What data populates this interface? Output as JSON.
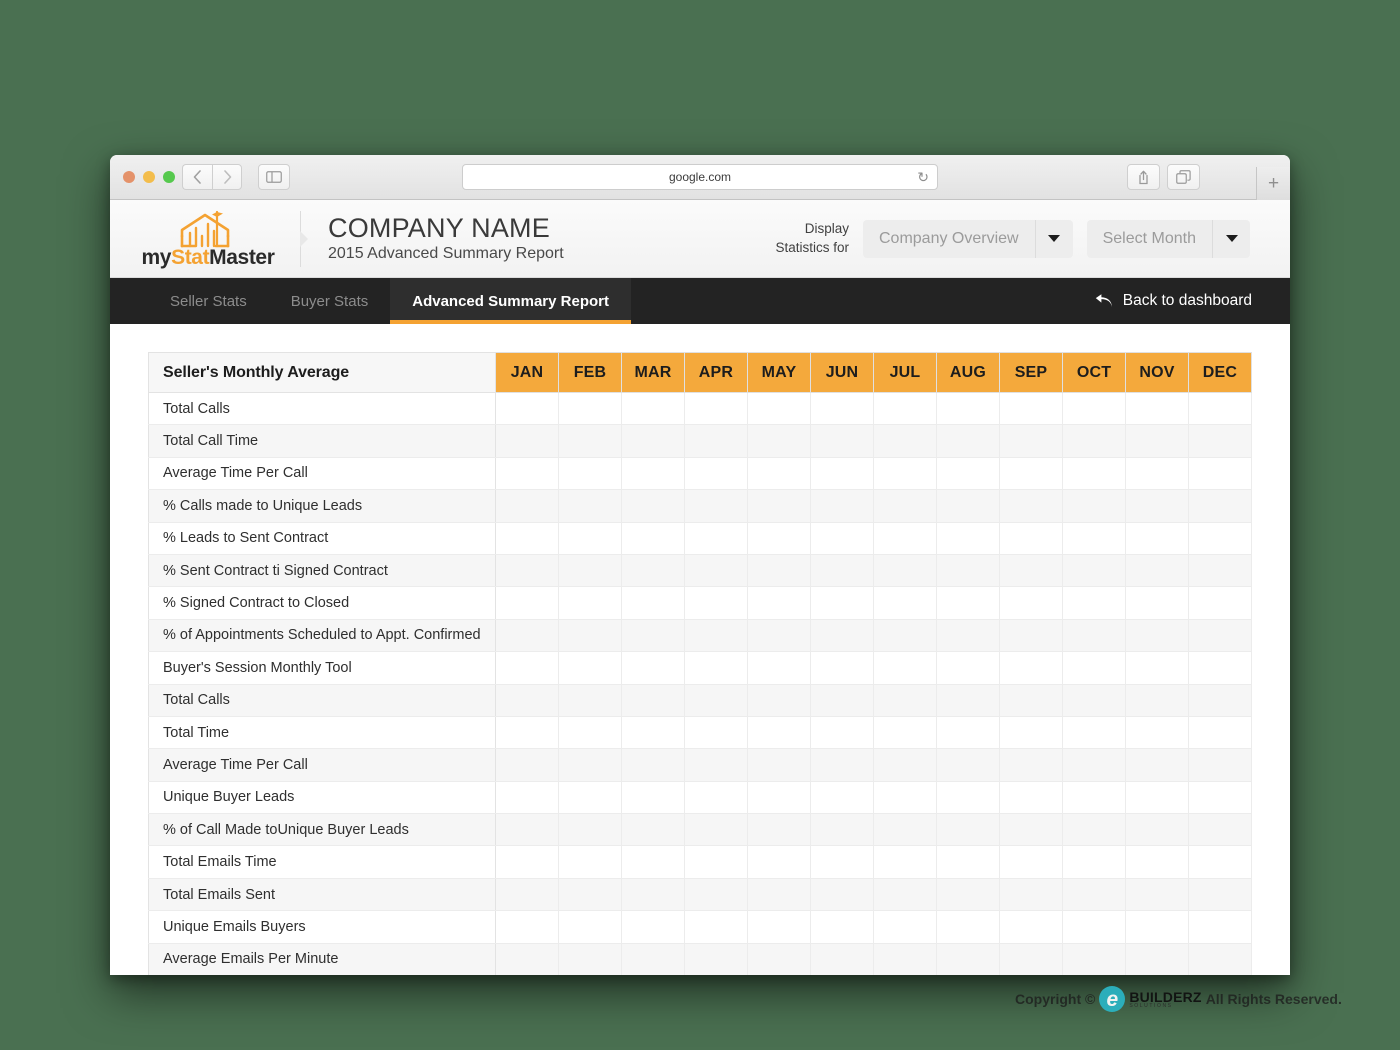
{
  "browser": {
    "url": "google.com",
    "back_icon": "chevron-left-icon",
    "forward_icon": "chevron-right-icon",
    "sidebar_icon": "sidebar-toggle-icon",
    "reload_icon": "↻",
    "share_icon": "share-icon",
    "tabs_icon": "show-tabs-icon",
    "new_tab_label": "+"
  },
  "header": {
    "logo_word_part1": "my",
    "logo_word_part2": "Stat",
    "logo_word_part3": "Master",
    "company_name": "COMPANY NAME",
    "report_subtitle": "2015 Advanced Summary Report",
    "display_label_line1": "Display",
    "display_label_line2": "Statistics for",
    "dropdowns": [
      {
        "value": "Company Overview"
      },
      {
        "value": "Select Month"
      }
    ]
  },
  "nav": {
    "tabs": [
      {
        "label": "Seller Stats",
        "active": false
      },
      {
        "label": "Buyer Stats",
        "active": false
      },
      {
        "label": "Advanced Summary Report",
        "active": true
      }
    ],
    "back_to_dashboard": "Back to dashboard"
  },
  "table": {
    "row_header_title": "Seller's Monthly Average",
    "months": [
      "JAN",
      "FEB",
      "MAR",
      "APR",
      "MAY",
      "JUN",
      "JUL",
      "AUG",
      "SEP",
      "OCT",
      "NOV",
      "DEC"
    ],
    "rows": [
      "Total Calls",
      "Total Call Time",
      "Average Time Per Call",
      "% Calls made to Unique Leads",
      "% Leads to Sent Contract",
      "% Sent Contract ti Signed Contract",
      "% Signed Contract to Closed",
      "% of Appointments Scheduled to Appt. Confirmed",
      "Buyer's Session Monthly Tool",
      "Total Calls",
      "Total Time",
      "Average Time Per Call",
      "Unique Buyer Leads",
      "% of Call Made toUnique Buyer Leads",
      "Total Emails Time",
      "Total Emails Sent",
      "Unique Emails Buyers",
      "Average Emails Per Minute"
    ]
  },
  "watermark": {
    "prefix": "Copyright ©",
    "logo_letter": "e",
    "brand": "BUILDERZ",
    "brand_sub": "SOLUTIONS",
    "suffix": "All Rights Reserved."
  },
  "colors": {
    "page_background": "#4a7051",
    "accent_orange": "#f4a93c",
    "nav_dark": "#232323",
    "nav_active": "#2e2e2e",
    "watermark_teal": "#2bb5c4"
  }
}
